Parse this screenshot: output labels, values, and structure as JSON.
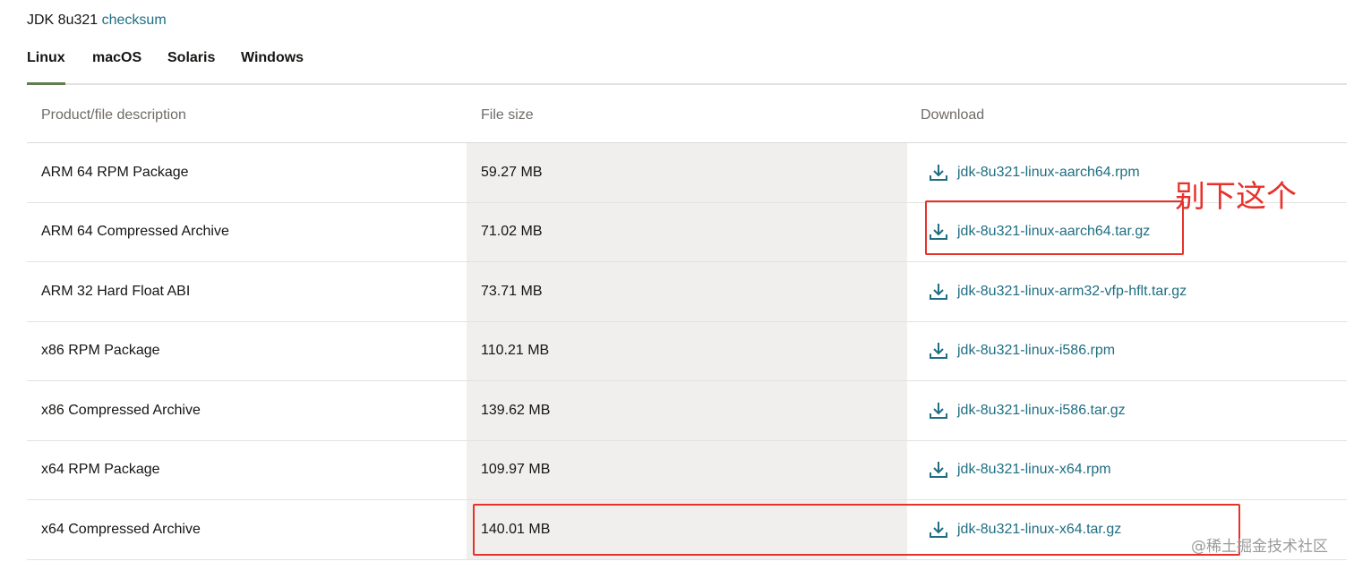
{
  "header": {
    "title": "JDK 8u321",
    "checksum_link": "checksum"
  },
  "tabs": [
    {
      "label": "Linux",
      "active": true
    },
    {
      "label": "macOS",
      "active": false
    },
    {
      "label": "Solaris",
      "active": false
    },
    {
      "label": "Windows",
      "active": false
    }
  ],
  "table": {
    "columns": [
      "Product/file description",
      "File size",
      "Download"
    ],
    "rows": [
      {
        "description": "ARM 64 RPM Package",
        "size": "59.27 MB",
        "file": "jdk-8u321-linux-aarch64.rpm"
      },
      {
        "description": "ARM 64 Compressed Archive",
        "size": "71.02 MB",
        "file": "jdk-8u321-linux-aarch64.tar.gz"
      },
      {
        "description": "ARM 32 Hard Float ABI",
        "size": "73.71 MB",
        "file": "jdk-8u321-linux-arm32-vfp-hflt.tar.gz"
      },
      {
        "description": "x86 RPM Package",
        "size": "110.21 MB",
        "file": "jdk-8u321-linux-i586.rpm"
      },
      {
        "description": "x86 Compressed Archive",
        "size": "139.62 MB",
        "file": "jdk-8u321-linux-i586.tar.gz"
      },
      {
        "description": "x64 RPM Package",
        "size": "109.97 MB",
        "file": "jdk-8u321-linux-x64.rpm"
      },
      {
        "description": "x64 Compressed Archive",
        "size": "140.01 MB",
        "file": "jdk-8u321-linux-x64.tar.gz"
      }
    ]
  },
  "annotation": {
    "note": "别下这个",
    "color": "#e8312a"
  },
  "watermark": "@稀土掘金技术社区",
  "colors": {
    "link": "#1f6e82",
    "active_tab_underline": "#5f7d4f",
    "size_column_bg": "#f1efed"
  },
  "icons": {
    "download": "download-icon"
  }
}
